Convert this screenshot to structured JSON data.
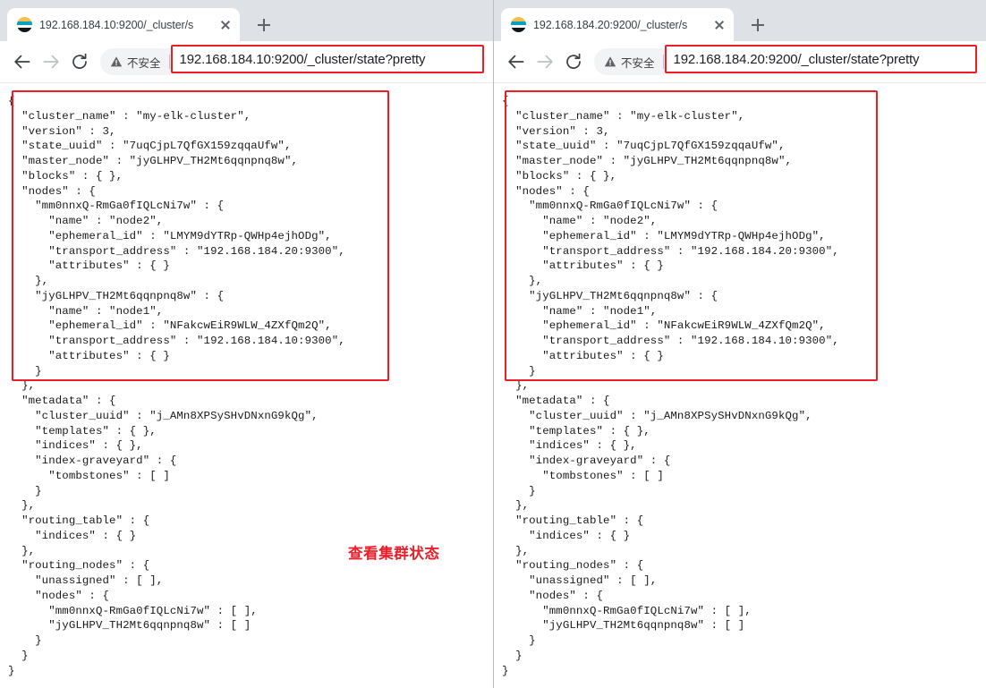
{
  "windows": [
    {
      "tab": {
        "title": "192.168.184.10:9200/_cluster/s",
        "favicon_name": "elasticsearch-favicon",
        "close_label": "×",
        "new_tab_label": "+"
      },
      "toolbar": {
        "back_label": "←",
        "forward_label": "→",
        "reload_label": "↻",
        "security_warning": "不安全",
        "url": "192.168.184.10:9200/_cluster/state?pretty"
      },
      "body_json": "{\n  \"cluster_name\" : \"my-elk-cluster\",\n  \"version\" : 3,\n  \"state_uuid\" : \"7uqCjpL7QfGX159zqqaUfw\",\n  \"master_node\" : \"jyGLHPV_TH2Mt6qqnpnq8w\",\n  \"blocks\" : { },\n  \"nodes\" : {\n    \"mm0nnxQ-RmGa0fIQLcNi7w\" : {\n      \"name\" : \"node2\",\n      \"ephemeral_id\" : \"LMYM9dYTRp-QWHp4ejhODg\",\n      \"transport_address\" : \"192.168.184.20:9300\",\n      \"attributes\" : { }\n    },\n    \"jyGLHPV_TH2Mt6qqnpnq8w\" : {\n      \"name\" : \"node1\",\n      \"ephemeral_id\" : \"NFakcwEiR9WLW_4ZXfQm2Q\",\n      \"transport_address\" : \"192.168.184.10:9300\",\n      \"attributes\" : { }\n    }\n  },\n  \"metadata\" : {\n    \"cluster_uuid\" : \"j_AMn8XPSySHvDNxnG9kQg\",\n    \"templates\" : { },\n    \"indices\" : { },\n    \"index-graveyard\" : {\n      \"tombstones\" : [ ]\n    }\n  },\n  \"routing_table\" : {\n    \"indices\" : { }\n  },\n  \"routing_nodes\" : {\n    \"unassigned\" : [ ],\n    \"nodes\" : {\n      \"mm0nnxQ-RmGa0fIQLcNi7w\" : [ ],\n      \"jyGLHPV_TH2Mt6qqnpnq8w\" : [ ]\n    }\n  }\n}"
    },
    {
      "tab": {
        "title": "192.168.184.20:9200/_cluster/s",
        "favicon_name": "elasticsearch-favicon",
        "close_label": "×",
        "new_tab_label": "+"
      },
      "toolbar": {
        "back_label": "←",
        "forward_label": "→",
        "reload_label": "↻",
        "security_warning": "不安全",
        "url": "192.168.184.20:9200/_cluster/state?pretty"
      },
      "body_json": "{\n  \"cluster_name\" : \"my-elk-cluster\",\n  \"version\" : 3,\n  \"state_uuid\" : \"7uqCjpL7QfGX159zqqaUfw\",\n  \"master_node\" : \"jyGLHPV_TH2Mt6qqnpnq8w\",\n  \"blocks\" : { },\n  \"nodes\" : {\n    \"mm0nnxQ-RmGa0fIQLcNi7w\" : {\n      \"name\" : \"node2\",\n      \"ephemeral_id\" : \"LMYM9dYTRp-QWHp4ejhODg\",\n      \"transport_address\" : \"192.168.184.20:9300\",\n      \"attributes\" : { }\n    },\n    \"jyGLHPV_TH2Mt6qqnpnq8w\" : {\n      \"name\" : \"node1\",\n      \"ephemeral_id\" : \"NFakcwEiR9WLW_4ZXfQm2Q\",\n      \"transport_address\" : \"192.168.184.10:9300\",\n      \"attributes\" : { }\n    }\n  },\n  \"metadata\" : {\n    \"cluster_uuid\" : \"j_AMn8XPSySHvDNxnG9kQg\",\n    \"templates\" : { },\n    \"indices\" : { },\n    \"index-graveyard\" : {\n      \"tombstones\" : [ ]\n    }\n  },\n  \"routing_table\" : {\n    \"indices\" : { }\n  },\n  \"routing_nodes\" : {\n    \"unassigned\" : [ ],\n    \"nodes\" : {\n      \"mm0nnxQ-RmGa0fIQLcNi7w\" : [ ],\n      \"jyGLHPV_TH2Mt6qqnpnq8w\" : [ ]\n    }\n  }\n}"
    }
  ],
  "annotations": {
    "highlight_color": "#ee1c25",
    "note_text": "查看集群状态"
  }
}
